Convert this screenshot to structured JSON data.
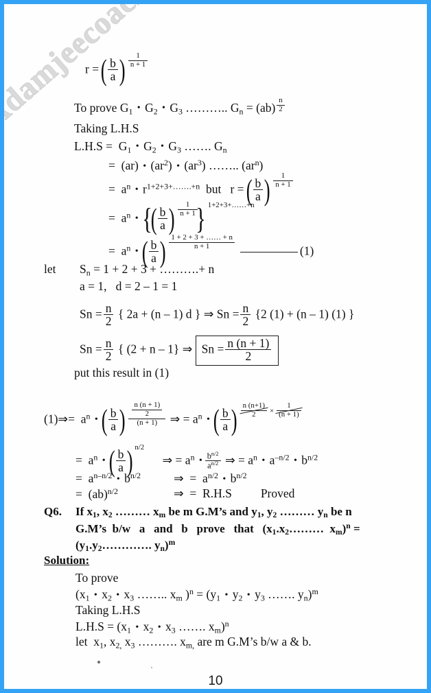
{
  "document": {
    "type": "scanned-textbook-page",
    "subject": "Mathematics - Geometric Means (G.M)",
    "page_number": "10",
    "border_color": "#34a3f5",
    "paper_color": "#fefefe",
    "watermark": {
      "text": "Adamjeecoaching.blogspot.com",
      "color": "#d9d9d9",
      "rotation_deg": -41
    }
  },
  "lines": {
    "l01_r_equals": "r =",
    "l02_to_prove_pre": "To prove G",
    "l02_to_prove": "To prove G1 . G2 . G3 ……….. Gn = (ab)n/2",
    "l03_taking_lhs": "Taking L.H.S",
    "l04_lhs_eq": "L.H.S =",
    "l04_lhs_terms": "G1 . G2 . G3 ……. Gn",
    "l05_eq": "=",
    "l05_terms": "(ar) . (ar2) . (ar3) …….. (arn)",
    "l06_eq": "=",
    "l06_an": "an",
    "l06_r_exp": "r1+2+3+……+n",
    "l06_but": "but",
    "l06_r_eq": "r =",
    "l07_eq": "=",
    "l07_an": "an",
    "l07_exp": "1+2+3+……+n",
    "l08_eq": "=",
    "l08_an": "an",
    "l08_num": "1 + 2 + 3 + …… + n",
    "l08_den": "n + 1",
    "l08_ref": "(1)",
    "l09_let": "let",
    "l09_sn": "Sn = 1 + 2 + 3 + ……….+ n",
    "l10_ad": "a = 1,   d = 2 – 1 = 1",
    "l11_left": "Sn =",
    "l11_brace": "{ 2a + (n – 1) d }",
    "l11_imply": "⇒",
    "l11_right_sn": "Sn =",
    "l11_right_brace": "{2 (1) + (n – 1) (1) }",
    "l12_left": "Sn =",
    "l12_brace": "{ (2 + n – 1}",
    "l12_imply": "⇒",
    "l12_boxed_sn": "Sn =",
    "l12_boxed_num": "n (n + 1)",
    "l12_boxed_den": "2",
    "l13_put": "put this result in (1)",
    "l14_ref": "(1)⇒=",
    "l14_an": "an",
    "l14_imply": "⇒  =",
    "l14_an2": "an",
    "l15_eq": "=",
    "l15_an": "an",
    "l15_exp": "n/2",
    "l15_imply1": "⇒  =",
    "l15_an2": "an",
    "l15_frac_num": "bn/2",
    "l15_frac_den": "an/2",
    "l15_imply2": "⇒  =",
    "l15_tail": "an . a–n/2 . bn/2",
    "l16_eq": "= an–n/2 . bn/2",
    "l16_imply": "⇒  =  an/2 . bn/2",
    "l17_eq": "= (ab)n/2",
    "l17_imply": "⇒  =  R.H.S",
    "l17_proved": "Proved",
    "q6_label": "Q6.",
    "q6_line1": "If x1, x2 ……… xm be m G.M's and y1, y2 ……… yn be n",
    "q6_line2": "G.M's b/w  a  and  b  prove  that  (x1.x2………  xm)n  =",
    "q6_line3": "(y1.y2…………. yn)m",
    "solution_label": "Solution:",
    "s01": "To prove",
    "s02": "(x1 • x2 • x3 …….. xm )n = (y1 • y2 • y3 ……. yn)m",
    "s03": "Taking L.H.S",
    "s04": "L.H.S = (x1 • x2 • x3 ……. xm)n",
    "s05": "let  x1, x2, x3 ………. xm, are m G.M's b/w a & b."
  },
  "symbols": {
    "b": "b",
    "a": "a",
    "one": "1",
    "n_plus_1": "n + 1",
    "n_over_2_num": "n",
    "n_over_2_den": "2",
    "ab": "(ab)",
    "exp_n_over_2": "n/2",
    "n_n1_num": "n (n + 1)",
    "two": "2",
    "paren_n1": "(n + 1)",
    "times": "×",
    "dots_small": "……",
    "n_n1_inline": "n (n+1)"
  },
  "page_footer": {
    "number": "10"
  }
}
